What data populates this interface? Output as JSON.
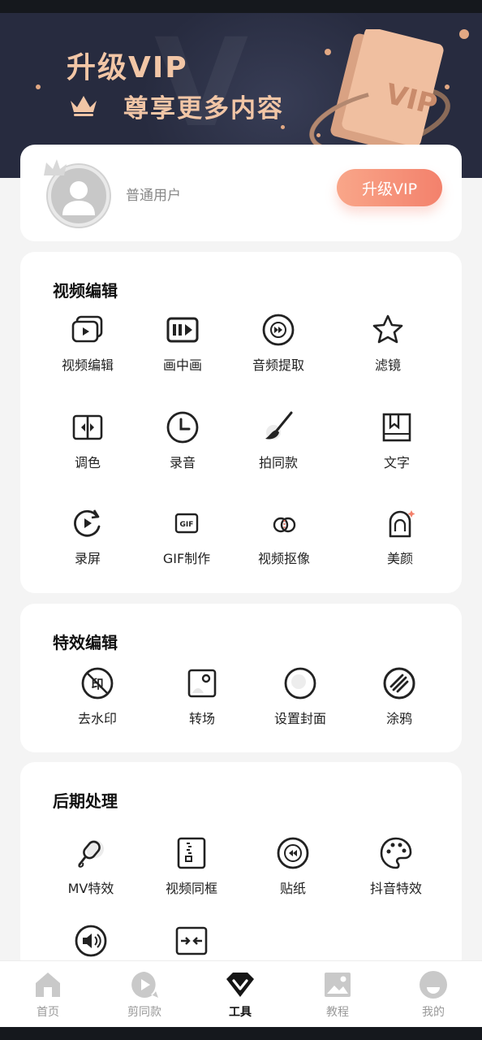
{
  "banner": {
    "title": "升级VIP",
    "subtitle": "尊享更多内容",
    "card_text": "VIP",
    "colors": {
      "bg": "#272b3f",
      "gold": "#f2c6a6"
    }
  },
  "user": {
    "name": "普通用户",
    "upgrade_label": "升级VIP"
  },
  "video_edit": {
    "title": "视频编辑",
    "tools": [
      {
        "label": "视频编辑",
        "icon": "video-clips-icon"
      },
      {
        "label": "画中画",
        "icon": "picture-in-picture-icon"
      },
      {
        "label": "音频提取",
        "icon": "fast-forward-circle-icon"
      },
      {
        "label": "滤镜",
        "icon": "star-icon"
      },
      {
        "label": "调色",
        "icon": "split-arrows-icon"
      },
      {
        "label": "录音",
        "icon": "clock-icon"
      },
      {
        "label": "拍同款",
        "icon": "brush-icon"
      },
      {
        "label": "文字",
        "icon": "bookmark-frame-icon"
      },
      {
        "label": "录屏",
        "icon": "rotate-play-icon"
      },
      {
        "label": "GIF制作",
        "icon": "gif-icon"
      },
      {
        "label": "视频抠像",
        "icon": "overlap-circles-icon"
      },
      {
        "label": "美颜",
        "icon": "beauty-face-icon"
      }
    ]
  },
  "effects_edit": {
    "title": "特效编辑",
    "tools": [
      {
        "label": "去水印",
        "icon": "remove-watermark-icon",
        "glyph": "印"
      },
      {
        "label": "转场",
        "icon": "transition-icon"
      },
      {
        "label": "设置封面",
        "icon": "cover-circle-icon"
      },
      {
        "label": "涂鸦",
        "icon": "graffiti-icon"
      }
    ]
  },
  "post_processing": {
    "title": "后期处理",
    "tools": [
      {
        "label": "MV特效",
        "icon": "microphone-icon"
      },
      {
        "label": "视频同框",
        "icon": "zipper-frame-icon"
      },
      {
        "label": "贴纸",
        "icon": "rewind-circle-icon"
      },
      {
        "label": "抖音特效",
        "icon": "palette-icon"
      },
      {
        "label": "",
        "icon": "speaker-icon"
      },
      {
        "label": "",
        "icon": "compress-arrows-icon"
      }
    ]
  },
  "tabbar": {
    "tabs": [
      {
        "label": "首页",
        "icon": "home-icon"
      },
      {
        "label": "剪同款",
        "icon": "play-bubble-icon"
      },
      {
        "label": "工具",
        "icon": "diamond-v-icon",
        "active": true
      },
      {
        "label": "教程",
        "icon": "image-icon"
      },
      {
        "label": "我的",
        "icon": "profile-icon"
      }
    ]
  }
}
